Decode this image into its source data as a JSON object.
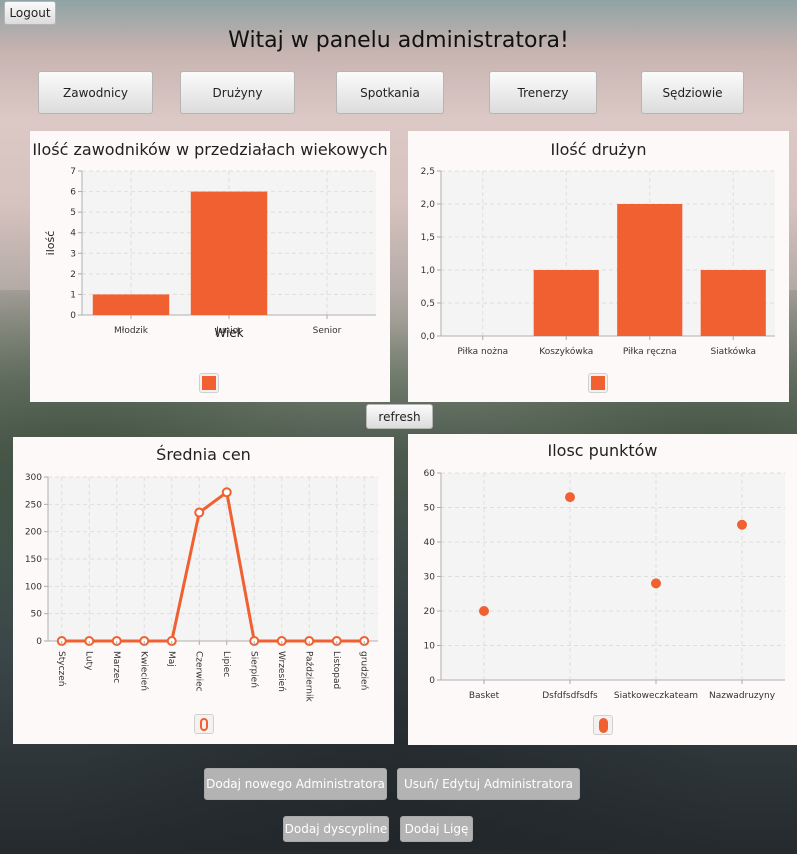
{
  "header": {
    "logout_label": "Logout",
    "title": "Witaj w panelu administratora!",
    "refresh_label": "refresh"
  },
  "nav": [
    {
      "id": "zawodnicy",
      "label": "Zawodnicy"
    },
    {
      "id": "druzyny",
      "label": "Drużyny"
    },
    {
      "id": "spotkania",
      "label": "Spotkania"
    },
    {
      "id": "trenerzy",
      "label": "Trenerzy"
    },
    {
      "id": "sedziowie",
      "label": "Sędziowie"
    }
  ],
  "actions": {
    "add_admin_label": "Dodaj nowego Administratora",
    "edit_admin_label": "Usuń/ Edytuj Administratora",
    "add_discipline_label": "Dodaj dyscypline",
    "add_league_label": "Dodaj Ligę"
  },
  "colors": {
    "accent": "#f06030",
    "panel": "#fdf9f8",
    "plot_bg": "#f4f4f4"
  },
  "chart_data": [
    {
      "id": "age",
      "type": "bar",
      "title": "Ilość zawodników w przedziałach wiekowych",
      "xlabel": "Wiek",
      "ylabel": "ilość",
      "categories": [
        "Młodzik",
        "Junior",
        "Senior"
      ],
      "values": [
        1,
        6,
        0
      ],
      "ylim": [
        0,
        7
      ],
      "yticks": [
        "0",
        "1",
        "2",
        "3",
        "4",
        "5",
        "6",
        "7"
      ],
      "grid": true,
      "legend": "bottom"
    },
    {
      "id": "teams",
      "type": "bar",
      "title": "Ilość drużyn",
      "xlabel": "",
      "ylabel": "",
      "categories": [
        "Piłka nożna",
        "Koszykówka",
        "Piłka ręczna",
        "Siatkówka"
      ],
      "values": [
        0,
        1,
        2,
        1
      ],
      "ylim": [
        0,
        2.5
      ],
      "yticks": [
        "0,0",
        "0,5",
        "1,0",
        "1,5",
        "2,0",
        "2,5"
      ],
      "grid": true,
      "legend": "bottom"
    },
    {
      "id": "prices",
      "type": "line",
      "title": "Średnia cen",
      "xlabel": "",
      "ylabel": "",
      "categories": [
        "Styczeń",
        "Luty",
        "Marzec",
        "Kwiecień",
        "Maj",
        "Czerwiec",
        "Lipiec",
        "Sierpień",
        "Wrzesień",
        "Październik",
        "Listopad",
        "grudzień"
      ],
      "values": [
        0,
        0,
        0,
        0,
        0,
        235,
        272,
        0,
        0,
        0,
        0,
        0
      ],
      "ylim": [
        0,
        300
      ],
      "yticks": [
        "0",
        "50",
        "100",
        "150",
        "200",
        "250",
        "300"
      ],
      "grid": true,
      "legend": "bottom"
    },
    {
      "id": "points",
      "type": "scatter",
      "title": "Ilosc punktów",
      "xlabel": "",
      "ylabel": "",
      "categories": [
        "Basket",
        "Dsfdfsdfsdfs",
        "Siatkoweczkateam",
        "Nazwadruzyny"
      ],
      "values": [
        20,
        53,
        28,
        45
      ],
      "ylim": [
        0,
        60
      ],
      "yticks": [
        "0",
        "10",
        "20",
        "30",
        "40",
        "50",
        "60"
      ],
      "grid": true,
      "legend": "bottom"
    }
  ]
}
